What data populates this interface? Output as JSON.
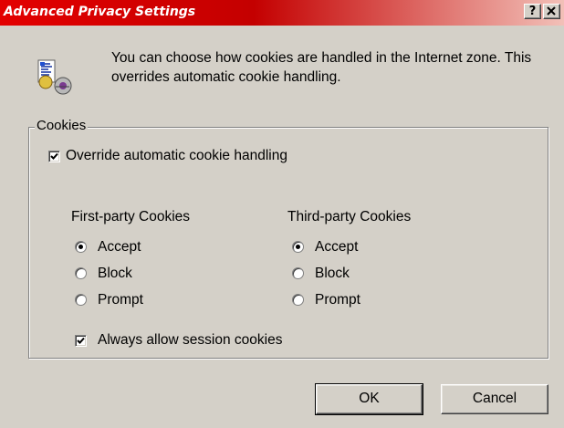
{
  "window": {
    "title": "Advanced Privacy Settings",
    "help_label": "?",
    "close_label": "✕"
  },
  "info": {
    "icon": "privacy-cookie-icon",
    "text": "You can choose how cookies are handled in the Internet zone.  This overrides automatic cookie handling."
  },
  "cookies": {
    "group_label": "Cookies",
    "override": {
      "label": "Override automatic cookie handling",
      "checked": true
    },
    "first_party": {
      "heading": "First-party Cookies",
      "options": [
        "Accept",
        "Block",
        "Prompt"
      ],
      "selected": "Accept"
    },
    "third_party": {
      "heading": "Third-party Cookies",
      "options": [
        "Accept",
        "Block",
        "Prompt"
      ],
      "selected": "Accept"
    },
    "session": {
      "label": "Always allow session cookies",
      "checked": true
    }
  },
  "buttons": {
    "ok": "OK",
    "cancel": "Cancel"
  }
}
